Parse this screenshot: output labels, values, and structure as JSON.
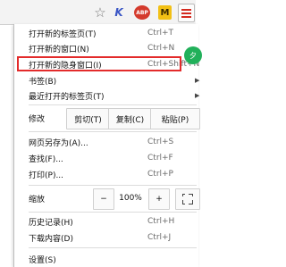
{
  "toolbar": {
    "icons": [
      "bookmark-star-icon",
      "extension-k-icon",
      "adblock-plus-icon",
      "extension-m-icon",
      "chrome-menu-icon"
    ],
    "abp_label": "ABP",
    "k_label": "K",
    "m_label": "M"
  },
  "menu": {
    "new_tab": {
      "label": "打开新的标签页(T)",
      "shortcut": "Ctrl+T"
    },
    "new_window": {
      "label": "打开新的窗口(N)",
      "shortcut": "Ctrl+N"
    },
    "incognito": {
      "label": "打开新的隐身窗口(I)",
      "shortcut": "Ctrl+Shift+N"
    },
    "bookmarks": {
      "label": "书签(B)"
    },
    "recent_tabs": {
      "label": "最近打开的标签页(T)"
    },
    "edit": {
      "label": "修改",
      "cut": "剪切(T)",
      "copy": "复制(C)",
      "paste": "粘贴(P)"
    },
    "save_as": {
      "label": "网页另存为(A)...",
      "shortcut": "Ctrl+S"
    },
    "find": {
      "label": "查找(F)...",
      "shortcut": "Ctrl+F"
    },
    "print": {
      "label": "打印(P)...",
      "shortcut": "Ctrl+P"
    },
    "zoom": {
      "label": "缩放",
      "minus": "−",
      "value": "100%",
      "plus": "+"
    },
    "history": {
      "label": "历史记录(H)",
      "shortcut": "Ctrl+H"
    },
    "downloads": {
      "label": "下载内容(D)",
      "shortcut": "Ctrl+J"
    },
    "settings": {
      "label": "设置(S)"
    }
  },
  "side_tab": {
    "label": "夕"
  },
  "colors": {
    "highlight": "#e32b2b",
    "accent_green": "#21b05a",
    "menu_icon": "#d42a20"
  }
}
